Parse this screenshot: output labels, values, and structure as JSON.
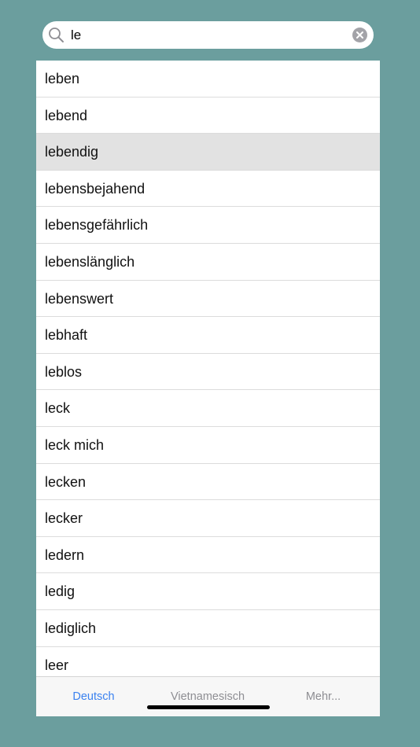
{
  "search": {
    "value": "le"
  },
  "words": [
    {
      "label": "leben",
      "selected": false
    },
    {
      "label": "lebend",
      "selected": false
    },
    {
      "label": "lebendig",
      "selected": true
    },
    {
      "label": "lebensbejahend",
      "selected": false
    },
    {
      "label": "lebensgefährlich",
      "selected": false
    },
    {
      "label": "lebenslänglich",
      "selected": false
    },
    {
      "label": "lebenswert",
      "selected": false
    },
    {
      "label": "lebhaft",
      "selected": false
    },
    {
      "label": "leblos",
      "selected": false
    },
    {
      "label": "leck",
      "selected": false
    },
    {
      "label": "leck mich",
      "selected": false
    },
    {
      "label": "lecken",
      "selected": false
    },
    {
      "label": "lecker",
      "selected": false
    },
    {
      "label": "ledern",
      "selected": false
    },
    {
      "label": "ledig",
      "selected": false
    },
    {
      "label": "lediglich",
      "selected": false
    },
    {
      "label": "leer",
      "selected": false
    }
  ],
  "tabs": [
    {
      "label": "Deutsch",
      "active": true
    },
    {
      "label": "Vietnamesisch",
      "active": false
    },
    {
      "label": "Mehr...",
      "active": false
    }
  ],
  "colors": {
    "background": "#6b9e9e",
    "active_tab": "#3b82f0",
    "inactive_tab": "#8e8e93",
    "selected_row": "#e2e2e2"
  },
  "icons": {
    "search": "magnifier-icon",
    "clear": "clear-circle-x-icon"
  }
}
